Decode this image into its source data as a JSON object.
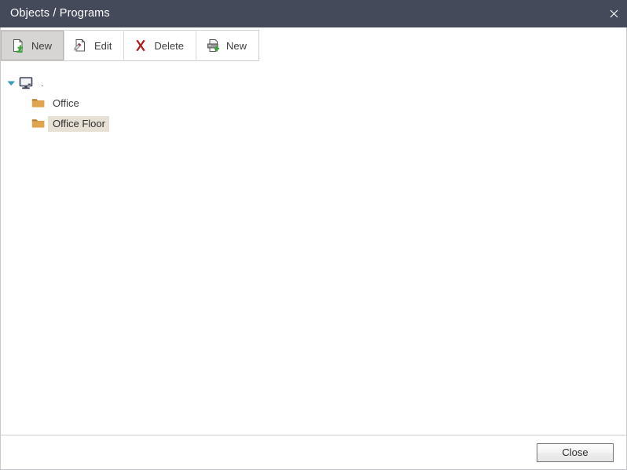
{
  "window": {
    "title": "Objects / Programs",
    "close_icon": "close-icon",
    "titlebar_color": "#454a5a"
  },
  "toolbar": {
    "buttons": [
      {
        "label": "New",
        "icon": "new-document-icon",
        "active": true
      },
      {
        "label": "Edit",
        "icon": "edit-document-icon",
        "active": false
      },
      {
        "label": "Delete",
        "icon": "delete-x-icon",
        "active": false
      },
      {
        "label": "New",
        "icon": "new-program-icon",
        "active": false
      }
    ]
  },
  "tree": {
    "root": {
      "label": ".",
      "icon": "computer-icon",
      "twisty": "chevron-down-icon",
      "expanded": true
    },
    "children": [
      {
        "label": "Office",
        "icon": "folder-icon",
        "selected": false
      },
      {
        "label": "Office Floor",
        "icon": "folder-icon",
        "selected": true
      }
    ]
  },
  "footer": {
    "close_label": "Close"
  },
  "colors": {
    "titlebar": "#454a5a",
    "selection": "#e6e0d5",
    "folder": "#e0a44c",
    "accent_green": "#3aa33a",
    "delete_red": "#b01b1b",
    "twisty": "#2f9bb0"
  }
}
